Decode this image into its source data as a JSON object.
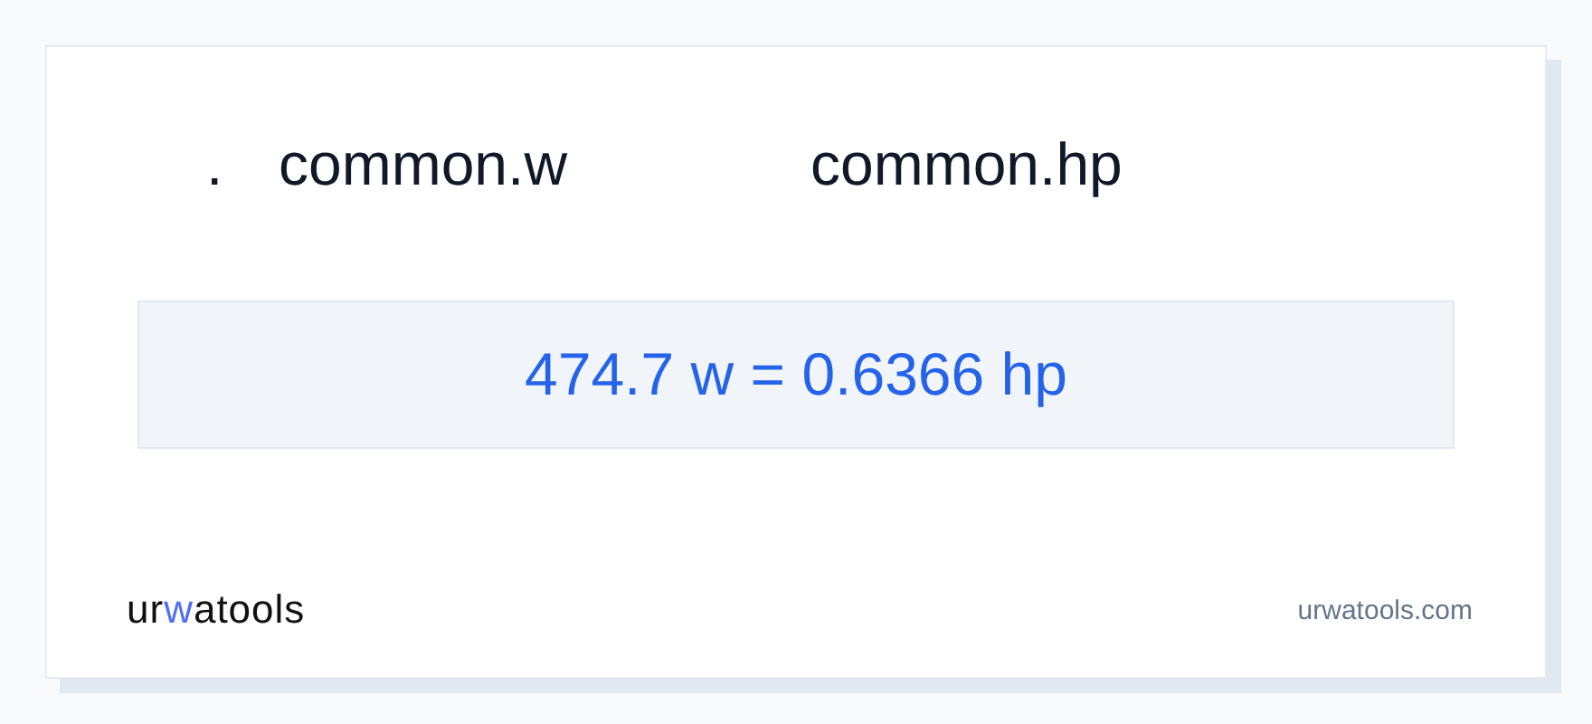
{
  "header": {
    "bullet": ".",
    "from_unit": "common.w",
    "to_unit": "common.hp"
  },
  "result": "474.7 w = 0.6366 hp",
  "logo": [
    {
      "text": "ur",
      "accent": false
    },
    {
      "text": "w",
      "accent": true
    },
    {
      "text": "atools",
      "accent": false
    }
  ],
  "site": "urwatools.com"
}
